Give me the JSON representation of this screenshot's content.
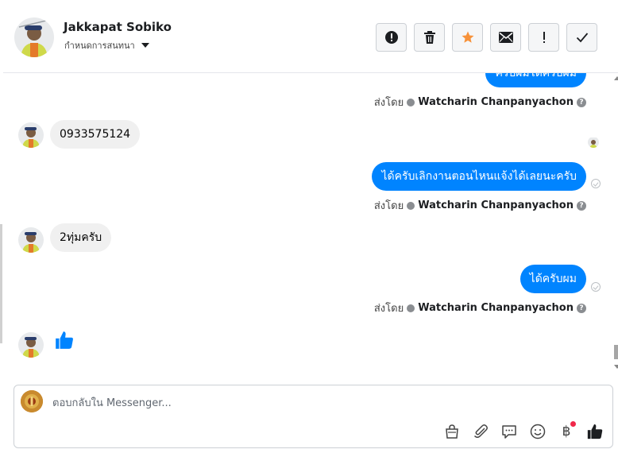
{
  "header": {
    "contact_name": "Jakkapat Sobiko",
    "label_menu": "กำหนดการสนทนา",
    "toolbar": [
      {
        "name": "report-button",
        "icon": "exclamation-circle-icon"
      },
      {
        "name": "delete-button",
        "icon": "trash-icon"
      },
      {
        "name": "star-button",
        "icon": "star-icon"
      },
      {
        "name": "mark-unread-button",
        "icon": "envelope-icon"
      },
      {
        "name": "priority-button",
        "icon": "exclamation-icon"
      },
      {
        "name": "done-button",
        "icon": "check-icon"
      }
    ]
  },
  "messages": [
    {
      "dir": "out",
      "text": "ครับผมได้ครับผม",
      "clipped": true
    },
    {
      "dir": "meta",
      "prefix": "ส่งโดย",
      "sender": "Watcharin Chanpanyachon"
    },
    {
      "dir": "in",
      "text": "0933575124"
    },
    {
      "dir": "out",
      "text": "ได้ครับเลิกงานตอนไหนแจ้งได้เลยนะครับ"
    },
    {
      "dir": "meta",
      "prefix": "ส่งโดย",
      "sender": "Watcharin Chanpanyachon"
    },
    {
      "dir": "in",
      "text": "2ทุ่มครับ"
    },
    {
      "dir": "out",
      "text": "ได้ครับผม"
    },
    {
      "dir": "meta",
      "prefix": "ส่งโดย",
      "sender": "Watcharin Chanpanyachon"
    },
    {
      "dir": "in",
      "text": "",
      "icon": "thumbs-up-icon"
    }
  ],
  "composer": {
    "placeholder": "ตอบกลับใน Messenger...",
    "value": "",
    "icons": [
      "shopping-bag-icon",
      "paperclip-icon",
      "chat-bubble-icon",
      "smiley-icon",
      "baht-icon",
      "thumbs-up-icon"
    ]
  },
  "colors": {
    "accent": "#0084ff",
    "star": "#f7923a",
    "incoming_bubble": "#f0f0f0",
    "notification_dot": "#f02849"
  }
}
